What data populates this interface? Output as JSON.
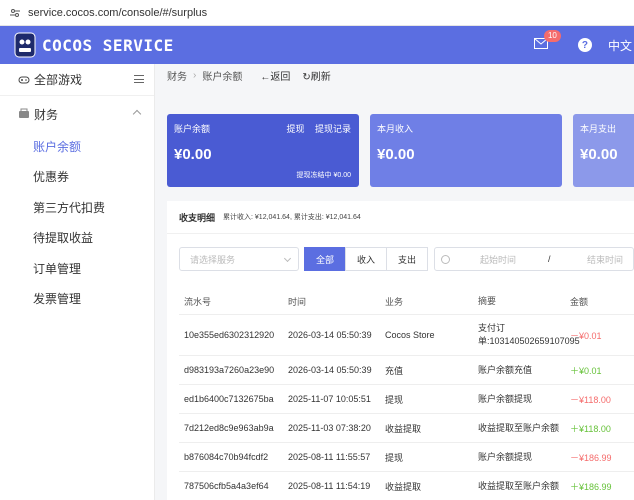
{
  "browser": {
    "url": "service.cocos.com/console/#/surplus"
  },
  "header": {
    "logo_text": "COCOS SERVICE",
    "mail_badge": "10",
    "help_glyph": "?",
    "lang": "中文"
  },
  "sidebar": {
    "all_games": "全部游戏",
    "finance": "财务",
    "items": [
      {
        "label": "账户余额",
        "active": true
      },
      {
        "label": "优惠券"
      },
      {
        "label": "第三方代扣费"
      },
      {
        "label": "待提取收益"
      },
      {
        "label": "订单管理"
      },
      {
        "label": "发票管理"
      }
    ]
  },
  "breadcrumb": {
    "root": "财务",
    "sep": "›",
    "current": "账户余额",
    "back": "←返回",
    "refresh": "刷新"
  },
  "cards": [
    {
      "label": "账户余额",
      "amount": "¥0.00",
      "withdraw": "提现",
      "withdraw_record": "提现记录",
      "frozen": "提现冻结中 ¥0.00"
    },
    {
      "label": "本月收入",
      "amount": "¥0.00"
    },
    {
      "label": "本月支出",
      "amount": "¥0.00"
    }
  ],
  "detail": {
    "title": "收支明细",
    "stats": "累计收入: ¥12,041.64, 累计支出: ¥12,041.64",
    "service_placeholder": "请选择服务",
    "segments": [
      "全部",
      "收入",
      "支出"
    ],
    "start_placeholder": "起始时间",
    "range_sep": "/",
    "end_placeholder": "结束时间"
  },
  "table": {
    "headers": [
      "流水号",
      "时间",
      "业务",
      "摘要",
      "金额"
    ],
    "rows": [
      {
        "id": "10e355ed6302312920",
        "time": "2026-03-14 05:50:39",
        "biz": "Cocos Store",
        "summary": "支付订单:103140502659107095",
        "amount": "－¥0.01",
        "sign": "neg"
      },
      {
        "id": "d983193a7260a23e90",
        "time": "2026-03-14 05:50:39",
        "biz": "充值",
        "summary": "账户余额充值",
        "amount": "＋¥0.01",
        "sign": "pos"
      },
      {
        "id": "ed1b6400c7132675ba",
        "time": "2025-11-07 10:05:51",
        "biz": "提现",
        "summary": "账户余额提现",
        "amount": "－¥118.00",
        "sign": "neg"
      },
      {
        "id": "7d212ed8c9e963ab9a",
        "time": "2025-11-03 07:38:20",
        "biz": "收益提取",
        "summary": "收益提取至账户余额",
        "amount": "＋¥118.00",
        "sign": "pos"
      },
      {
        "id": "b876084c70b94fcdf2",
        "time": "2025-08-11 11:55:57",
        "biz": "提现",
        "summary": "账户余额提现",
        "amount": "－¥186.99",
        "sign": "neg"
      },
      {
        "id": "787506cfb5a4a3ef64",
        "time": "2025-08-11 11:54:19",
        "biz": "收益提取",
        "summary": "收益提取至账户余额",
        "amount": "＋¥186.99",
        "sign": "pos"
      }
    ]
  },
  "colors": {
    "primary": "#5b6ee1",
    "card1": "#4a5bd3",
    "card2": "#6f7fe6",
    "negative": "#f56c6c",
    "positive": "#67c23a"
  }
}
